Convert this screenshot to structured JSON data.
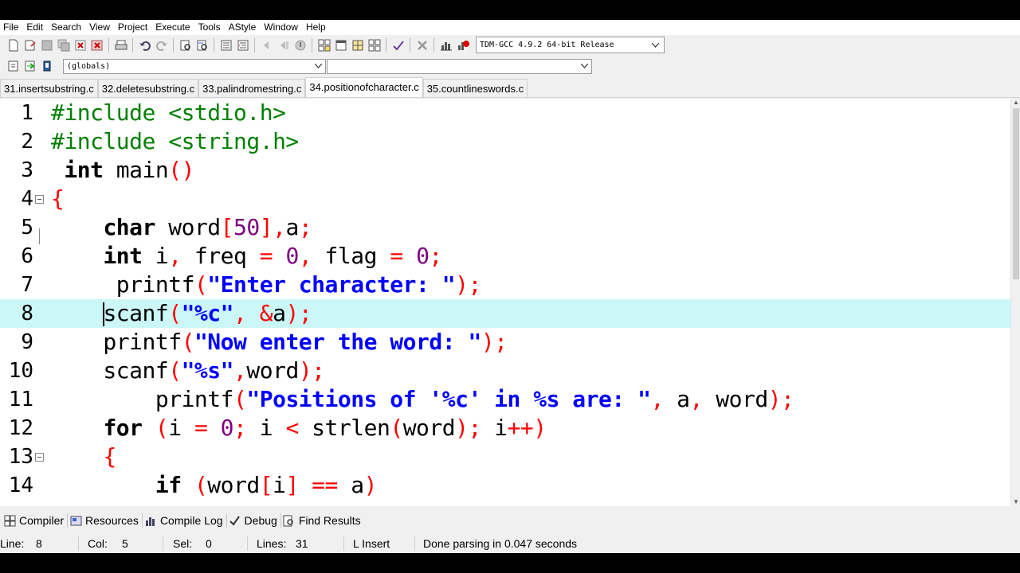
{
  "menu": [
    "File",
    "Edit",
    "Search",
    "View",
    "Project",
    "Execute",
    "Tools",
    "AStyle",
    "Window",
    "Help"
  ],
  "toolbar": {
    "compiler_profile": "TDM-GCC 4.9.2 64-bit Release"
  },
  "class_browser": {
    "scope": "(globals)",
    "member": ""
  },
  "tabs": [
    "31.insertsubstring.c",
    "32.deletesubstring.c",
    "33.palindromestring.c",
    "34.positionofcharacter.c",
    "35.countlineswords.c"
  ],
  "active_tab_index": 3,
  "editor": {
    "current_line": 8,
    "lines": [
      {
        "n": "1",
        "tokens": [
          [
            "pp",
            "#include <stdio.h>"
          ]
        ]
      },
      {
        "n": "2",
        "tokens": [
          [
            "pp",
            "#include <string.h>"
          ]
        ]
      },
      {
        "n": "3",
        "tokens": [
          [
            "id",
            " "
          ],
          [
            "kw",
            "int"
          ],
          [
            "id",
            " main"
          ],
          [
            "sym",
            "()"
          ]
        ]
      },
      {
        "n": "4",
        "tokens": [
          [
            "sym",
            "{"
          ]
        ]
      },
      {
        "n": "5",
        "tokens": [
          [
            "id",
            "    "
          ],
          [
            "kw",
            "char"
          ],
          [
            "id",
            " word"
          ],
          [
            "sym",
            "["
          ],
          [
            "num",
            "50"
          ],
          [
            "sym",
            "],"
          ],
          [
            "id",
            "a"
          ],
          [
            "sym",
            ";"
          ]
        ]
      },
      {
        "n": "6",
        "tokens": [
          [
            "id",
            "    "
          ],
          [
            "kw",
            "int"
          ],
          [
            "id",
            " i"
          ],
          [
            "sym",
            ","
          ],
          [
            "id",
            " freq "
          ],
          [
            "sym",
            "="
          ],
          [
            "id",
            " "
          ],
          [
            "num",
            "0"
          ],
          [
            "sym",
            ","
          ],
          [
            "id",
            " flag "
          ],
          [
            "sym",
            "="
          ],
          [
            "id",
            " "
          ],
          [
            "num",
            "0"
          ],
          [
            "sym",
            ";"
          ]
        ]
      },
      {
        "n": "7",
        "tokens": [
          [
            "id",
            "     printf"
          ],
          [
            "sym",
            "("
          ],
          [
            "str",
            "\"Enter character: \""
          ],
          [
            "sym",
            ");"
          ]
        ]
      },
      {
        "n": "8",
        "tokens": [
          [
            "id",
            "    "
          ],
          [
            "caret",
            ""
          ],
          [
            "id",
            "scanf"
          ],
          [
            "sym",
            "("
          ],
          [
            "str",
            "\"%c\""
          ],
          [
            "sym",
            ","
          ],
          [
            "id",
            " "
          ],
          [
            "sym",
            "&"
          ],
          [
            "id",
            "a"
          ],
          [
            "sym",
            ");"
          ]
        ]
      },
      {
        "n": "9",
        "tokens": [
          [
            "id",
            "    printf"
          ],
          [
            "sym",
            "("
          ],
          [
            "str",
            "\"Now enter the word: \""
          ],
          [
            "sym",
            ");"
          ]
        ]
      },
      {
        "n": "10",
        "tokens": [
          [
            "id",
            "    scanf"
          ],
          [
            "sym",
            "("
          ],
          [
            "str",
            "\"%s\""
          ],
          [
            "sym",
            ","
          ],
          [
            "id",
            "word"
          ],
          [
            "sym",
            ");"
          ]
        ]
      },
      {
        "n": "11",
        "tokens": [
          [
            "id",
            "        printf"
          ],
          [
            "sym",
            "("
          ],
          [
            "str",
            "\"Positions of '%c' in %s are: \""
          ],
          [
            "sym",
            ","
          ],
          [
            "id",
            " a"
          ],
          [
            "sym",
            ","
          ],
          [
            "id",
            " word"
          ],
          [
            "sym",
            ");"
          ]
        ]
      },
      {
        "n": "12",
        "tokens": [
          [
            "id",
            "    "
          ],
          [
            "kw",
            "for"
          ],
          [
            "id",
            " "
          ],
          [
            "sym",
            "("
          ],
          [
            "id",
            "i "
          ],
          [
            "sym",
            "="
          ],
          [
            "id",
            " "
          ],
          [
            "num",
            "0"
          ],
          [
            "sym",
            ";"
          ],
          [
            "id",
            " i "
          ],
          [
            "sym",
            "<"
          ],
          [
            "id",
            " strlen"
          ],
          [
            "sym",
            "("
          ],
          [
            "id",
            "word"
          ],
          [
            "sym",
            ");"
          ],
          [
            "id",
            " i"
          ],
          [
            "sym",
            "++)"
          ]
        ]
      },
      {
        "n": "13",
        "tokens": [
          [
            "id",
            "    "
          ],
          [
            "sym",
            "{"
          ]
        ]
      },
      {
        "n": "14",
        "tokens": [
          [
            "id",
            "        "
          ],
          [
            "kw",
            "if"
          ],
          [
            "id",
            " "
          ],
          [
            "sym",
            "("
          ],
          [
            "id",
            "word"
          ],
          [
            "sym",
            "["
          ],
          [
            "id",
            "i"
          ],
          [
            "sym",
            "]"
          ],
          [
            "id",
            " "
          ],
          [
            "sym",
            "=="
          ],
          [
            "id",
            " a"
          ],
          [
            "sym",
            ")"
          ]
        ]
      }
    ]
  },
  "bottom_tabs": [
    "Compiler",
    "Resources",
    "Compile Log",
    "Debug",
    "Find Results"
  ],
  "status": {
    "line_label": "Line:",
    "line_value": "8",
    "col_label": "Col:",
    "col_value": "5",
    "sel_label": "Sel:",
    "sel_value": "0",
    "lines_label": "Lines:",
    "lines_value": "31",
    "mode": "L Insert",
    "message": "Done parsing in 0.047 seconds"
  }
}
